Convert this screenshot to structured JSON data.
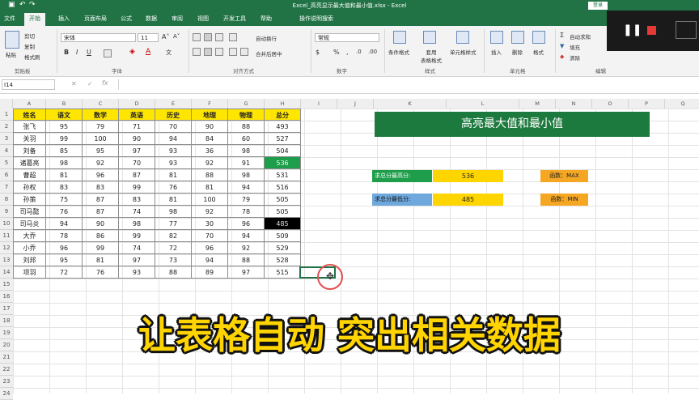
{
  "window": {
    "title": "Excel_高亮显示最大值和最小值.xlsx - Excel",
    "login": "登录"
  },
  "tabs": [
    "文件",
    "开始",
    "插入",
    "页面布局",
    "公式",
    "数据",
    "审阅",
    "视图",
    "开发工具",
    "帮助",
    "操作说明搜索"
  ],
  "ribbon": {
    "clipboard": {
      "cut": "剪切",
      "copy": "复制",
      "format_painter": "格式刷",
      "paste": "粘贴",
      "group": "剪贴板"
    },
    "font": {
      "name": "宋体",
      "size": "11",
      "group": "字体"
    },
    "alignment": {
      "wrap": "自动换行",
      "merge": "合并后居中",
      "group": "对齐方式"
    },
    "number": {
      "format": "常规",
      "group": "数字"
    },
    "styles": {
      "conditional": "条件格式",
      "table": "套用\n表格格式",
      "cell": "单元格样式",
      "group": "样式"
    },
    "cells": {
      "insert": "插入",
      "delete": "删除",
      "format": "格式",
      "group": "单元格"
    },
    "editing": {
      "autosum": "自动求和",
      "fill": "填充",
      "clear": "清除",
      "group": "编辑"
    }
  },
  "namebox": "I14",
  "columns": [
    "A",
    "B",
    "C",
    "D",
    "E",
    "F",
    "G",
    "H",
    "I",
    "J",
    "K",
    "L",
    "M",
    "N",
    "O",
    "P",
    "Q"
  ],
  "table": {
    "headers": [
      "姓名",
      "语文",
      "数学",
      "英语",
      "历史",
      "地理",
      "物理",
      "总分"
    ],
    "rows": [
      [
        "张飞",
        "95",
        "79",
        "71",
        "70",
        "90",
        "88",
        "493"
      ],
      [
        "关羽",
        "99",
        "100",
        "90",
        "94",
        "84",
        "60",
        "527"
      ],
      [
        "刘备",
        "85",
        "95",
        "97",
        "93",
        "36",
        "98",
        "504"
      ],
      [
        "诸葛亮",
        "98",
        "92",
        "70",
        "93",
        "92",
        "91",
        "536"
      ],
      [
        "曹超",
        "81",
        "96",
        "87",
        "81",
        "88",
        "98",
        "531"
      ],
      [
        "孙权",
        "83",
        "83",
        "99",
        "76",
        "81",
        "94",
        "516"
      ],
      [
        "孙策",
        "75",
        "87",
        "83",
        "81",
        "100",
        "79",
        "505"
      ],
      [
        "司马懿",
        "76",
        "87",
        "74",
        "98",
        "92",
        "78",
        "505"
      ],
      [
        "司马炎",
        "94",
        "90",
        "98",
        "77",
        "30",
        "96",
        "485"
      ],
      [
        "大乔",
        "78",
        "86",
        "99",
        "82",
        "70",
        "94",
        "509"
      ],
      [
        "小乔",
        "96",
        "99",
        "74",
        "72",
        "96",
        "92",
        "529"
      ],
      [
        "刘邦",
        "95",
        "81",
        "97",
        "73",
        "94",
        "88",
        "528"
      ],
      [
        "项羽",
        "72",
        "76",
        "93",
        "88",
        "89",
        "97",
        "515"
      ]
    ]
  },
  "highlight_colors": {
    "max": "#1e9e4a",
    "min": "#000000"
  },
  "banner": "高亮最大值和最小值",
  "max_label": "求总分最高分:",
  "max_value": "536",
  "max_func": "函数：MAX",
  "min_label": "求总分最低分:",
  "min_value": "485",
  "min_func": "函数：MIN",
  "caption": "让表格自动 突出相关数据"
}
